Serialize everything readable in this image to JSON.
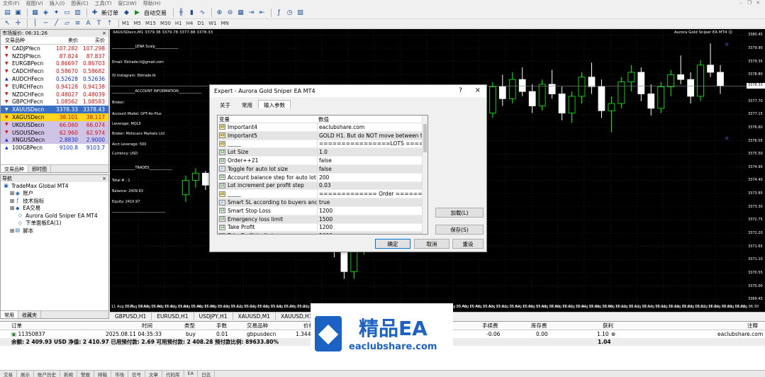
{
  "menu": [
    "文件(F)",
    "视图(V)",
    "插入(I)",
    "图表(C)",
    "工具(T)",
    "窗口(W)",
    "帮助(H)"
  ],
  "toolbar": {
    "new_order": "新订单",
    "auto_trading": "自动交易",
    "timeframes": [
      "M1",
      "M5",
      "M15",
      "M30",
      "H1",
      "H4",
      "D1",
      "W1",
      "MN"
    ]
  },
  "market_watch": {
    "title": "市场报价: 06:31:26",
    "col_symbol": "交易品种",
    "col_bid": "卖价",
    "col_ask": "买价",
    "rows": [
      {
        "symbol": "CADJPYecn",
        "bid": "107.282",
        "ask": "107.298",
        "style": "normal",
        "color": "#d01010"
      },
      {
        "symbol": "NZDJPYecn",
        "bid": "87.824",
        "ask": "87.837",
        "style": "normal",
        "color": "#d01010"
      },
      {
        "symbol": "EURGBPecn",
        "bid": "0.86697",
        "ask": "0.86703",
        "style": "normal",
        "color": "#d01010"
      },
      {
        "symbol": "CADCHFecn",
        "bid": "0.58670",
        "ask": "0.58682",
        "style": "normal",
        "color": "#d01010"
      },
      {
        "symbol": "AUDCHFecn",
        "bid": "0.52628",
        "ask": "0.52636",
        "style": "normal",
        "color": "#1030d0"
      },
      {
        "symbol": "EURCHFecn",
        "bid": "0.94128",
        "ask": "0.94138",
        "style": "normal",
        "color": "#d01010"
      },
      {
        "symbol": "NZDCHFecn",
        "bid": "0.48027",
        "ask": "0.48039",
        "style": "normal",
        "color": "#d01010"
      },
      {
        "symbol": "GBPCHFecn",
        "bid": "1.08562",
        "ask": "1.08583",
        "style": "normal",
        "color": "#d01010"
      },
      {
        "symbol": "XAUUSDecn",
        "bid": "3378.33",
        "ask": "3378.43",
        "style": "selected",
        "color": "#ffffff"
      },
      {
        "symbol": "XAGUSDecn",
        "bid": "38.101",
        "ask": "38.117",
        "style": "yellow",
        "color": "#d01010"
      },
      {
        "symbol": "UKOUSDecn",
        "bid": "66.060",
        "ask": "66.074",
        "style": "purple",
        "color": "#d01010"
      },
      {
        "symbol": "USOUSDecn",
        "bid": "62.960",
        "ask": "62.974",
        "style": "purple",
        "color": "#d01010"
      },
      {
        "symbol": "XNGUSDecn",
        "bid": "2.8830",
        "ask": "2.9000",
        "style": "purple",
        "color": "#1030d0"
      },
      {
        "symbol": "100GBPecn",
        "bid": "9100.8",
        "ask": "9103.7",
        "style": "normal",
        "color": "#1030d0"
      }
    ],
    "tabs": [
      "交易品种",
      "即时图"
    ]
  },
  "navigator": {
    "title": "导航",
    "items": [
      {
        "label": "TradeMax Global MT4",
        "indent": 0,
        "icon": "terminal-icon"
      },
      {
        "label": "账户",
        "indent": 1,
        "icon": "accounts-icon"
      },
      {
        "label": "技术指标",
        "indent": 1,
        "icon": "indicators-icon"
      },
      {
        "label": "EA交易",
        "indent": 1,
        "icon": "expert-advisors-icon"
      },
      {
        "label": "Aurora Gold Sniper EA MT4",
        "indent": 2,
        "icon": "ea-icon"
      },
      {
        "label": "下单面板EA(1)",
        "indent": 2,
        "icon": "ea-icon"
      },
      {
        "label": "脚本",
        "indent": 1,
        "icon": "scripts-icon"
      }
    ],
    "tabs": [
      "常用",
      "收藏夹"
    ]
  },
  "chart": {
    "title": "XAUUSDecn,M1  3379.38 3379.78 3377.88 3378.33",
    "ea_label": "Aurora Gold Sniper EA MT4 ☺",
    "overlay": [
      {
        "text": "_____________LENA Scalp_____________"
      },
      {
        "text": "Email:        Ebtrade.ti@gmail.com"
      },
      {
        "text": "ID Instagram:      Ebtrade.tk"
      },
      {
        "text": "_____________ACCOUNT INFORMATION_____________"
      },
      {
        "text": "Broker:"
      },
      {
        "text": "Account Model:     GPT-4o-Plus"
      },
      {
        "text": "Leverage:          MQL5"
      },
      {
        "text": "Broker:       Mohicans Markets Ltd"
      },
      {
        "text": "Acct Leverage:    500"
      },
      {
        "text": "Currency:         USD"
      },
      {
        "text": "_____________TRADES_____________"
      },
      {
        "text": "Total # :    1"
      },
      {
        "text": "Balance:          2409.93"
      },
      {
        "text": "Equity:           2410.97"
      },
      {
        "text": "______________________________"
      }
    ],
    "price_ticks": [
      "3380.45",
      "3379.90",
      "3379.35",
      "3378.80",
      "3378.25",
      "3377.70",
      "3377.15",
      "3376.60",
      "3376.05",
      "3375.50",
      "3374.95",
      "3374.40",
      "3373.85",
      "3373.30",
      "3372.75",
      "3372.20",
      "3371.65",
      "3371.10",
      "3370.55",
      "3370.00",
      "3369.45"
    ],
    "current_price": "3378.33",
    "time_ticks": [
      "11 Aug 2025",
      "11 Aug 04:58",
      "11 Aug 05:00",
      "11 Aug 05:02",
      "11 Aug 05:04",
      "11 Aug 05:06",
      "11 Aug 05:08",
      "11 Aug 05:10",
      "11 Aug 05:12",
      "11 Aug 05:14",
      "11 Aug 05:16",
      "11 Aug 05:18",
      "11 Aug 05:20",
      "11 Aug 05:22",
      "11 Aug 05:24",
      "11 Aug 05:26",
      "11 Aug 05:28",
      "11 Aug 05:30",
      "11 Aug 05:32",
      "11 Aug 05:34",
      "11 Aug 05:36",
      "11 Aug 05:38",
      "11 Aug 05:40",
      "11 Aug 05:42",
      "11 Aug 05:44",
      "11 Aug 05:46",
      "11 Aug 05:48",
      "11 Aug 05:50",
      "11 Aug 05:52",
      "11 Aug 05:54",
      "11 Aug 05:56",
      "11 Aug 05:58",
      "11 Aug 06:00",
      "11 Aug 06:02",
      "11 Aug 06:04",
      "11 Aug 06:06",
      "11 Aug 06:08",
      "11 Aug 06:10",
      "11 Aug 06:12",
      "11 Aug 06:14",
      "11 Aug 06:16",
      "11 Aug 06:18",
      "11 Aug 06:20",
      "11 Aug 06:22",
      "11 Aug 06:24",
      "11 Aug 06:26",
      "11 Aug 06:28",
      "11 Aug 06:30"
    ],
    "candle_up_color": "#00ff00",
    "candle_down_color": "#ffffff",
    "candles": [
      [
        3373.8,
        3374.6,
        3373.5,
        3374.4
      ],
      [
        3374.4,
        3374.9,
        3374.1,
        3374.7
      ],
      [
        3374.7,
        3374.8,
        3374.0,
        3374.2
      ],
      [
        3374.2,
        3374.5,
        3373.6,
        3373.9
      ],
      [
        3373.9,
        3374.3,
        3373.3,
        3373.6
      ],
      [
        3373.6,
        3374.0,
        3373.0,
        3373.8
      ],
      [
        3373.8,
        3374.8,
        3373.6,
        3374.6
      ],
      [
        3374.6,
        3375.2,
        3374.3,
        3374.9
      ],
      [
        3374.9,
        3375.0,
        3374.0,
        3374.2
      ],
      [
        3374.2,
        3374.4,
        3373.1,
        3373.4
      ],
      [
        3373.4,
        3373.9,
        3372.6,
        3373.0
      ],
      [
        3373.0,
        3373.4,
        3371.9,
        3372.2
      ],
      [
        3372.2,
        3373.2,
        3371.8,
        3372.9
      ],
      [
        3372.9,
        3373.6,
        3372.4,
        3373.4
      ],
      [
        3373.4,
        3373.8,
        3372.6,
        3372.8
      ],
      [
        3372.8,
        3373.1,
        3371.2,
        3371.5
      ],
      [
        3371.5,
        3372.0,
        3370.3,
        3370.6
      ],
      [
        3370.6,
        3371.9,
        3370.3,
        3371.6
      ],
      [
        3371.6,
        3372.7,
        3371.3,
        3372.5
      ],
      [
        3372.5,
        3373.4,
        3372.1,
        3373.2
      ],
      [
        3373.2,
        3373.6,
        3372.3,
        3372.6
      ],
      [
        3372.6,
        3373.9,
        3372.4,
        3373.7
      ],
      [
        3373.7,
        3374.6,
        3373.4,
        3374.3
      ],
      [
        3374.3,
        3375.2,
        3374.0,
        3375.0
      ],
      [
        3375.0,
        3375.6,
        3374.4,
        3374.8
      ],
      [
        3374.8,
        3375.9,
        3374.6,
        3375.7
      ],
      [
        3375.7,
        3376.4,
        3375.2,
        3376.1
      ],
      [
        3376.1,
        3376.8,
        3375.6,
        3375.9
      ],
      [
        3375.9,
        3377.2,
        3375.7,
        3377.0
      ],
      [
        3377.0,
        3377.9,
        3376.5,
        3377.6
      ],
      [
        3377.6,
        3378.1,
        3376.9,
        3377.2
      ],
      [
        3377.2,
        3378.5,
        3377.0,
        3378.3
      ],
      [
        3378.3,
        3378.8,
        3377.5,
        3377.8
      ],
      [
        3377.8,
        3378.9,
        3377.6,
        3378.6
      ],
      [
        3378.6,
        3379.1,
        3377.9,
        3378.1
      ],
      [
        3378.1,
        3378.4,
        3377.2,
        3377.5
      ],
      [
        3377.5,
        3378.6,
        3377.3,
        3378.4
      ],
      [
        3378.4,
        3379.0,
        3377.8,
        3378.0
      ],
      [
        3378.0,
        3378.3,
        3376.9,
        3377.2
      ],
      [
        3377.2,
        3378.1,
        3376.8,
        3377.9
      ],
      [
        3377.9,
        3378.9,
        3377.6,
        3378.7
      ],
      [
        3378.7,
        3379.3,
        3378.0,
        3378.3
      ],
      [
        3378.3,
        3378.6,
        3377.0,
        3377.3
      ],
      [
        3377.3,
        3377.9,
        3376.4,
        3377.6
      ],
      [
        3377.6,
        3378.7,
        3377.4,
        3378.5
      ],
      [
        3378.5,
        3379.2,
        3378.1,
        3378.9
      ],
      [
        3378.9,
        3379.1,
        3377.7,
        3378.0
      ],
      [
        3378.0,
        3378.4,
        3377.1,
        3377.4
      ],
      [
        3377.4,
        3378.5,
        3377.2,
        3378.3
      ],
      [
        3378.3,
        3379.0,
        3377.9,
        3378.8
      ],
      [
        3378.8,
        3379.6,
        3378.4,
        3378.6
      ],
      [
        3378.6,
        3378.9,
        3377.6,
        3377.9
      ],
      [
        3377.9,
        3379.4,
        3377.7,
        3379.2
      ],
      [
        3379.2,
        3380.1,
        3378.7,
        3378.9
      ],
      [
        3378.9,
        3379.2,
        3378.0,
        3378.33
      ]
    ],
    "markers": [
      {
        "label": "o",
        "price": 3380.0,
        "color": "#6a6aff"
      },
      {
        "label": "o",
        "price": 3376.1,
        "color": "#6a6aff"
      }
    ]
  },
  "chart_tabs": [
    "GBPUSD,H1",
    "EURUSD,H1",
    "USDJPY,H1",
    "XAUUSD,M1",
    "XAUUSD,H1",
    "XAUU"
  ],
  "terminal": {
    "headers": {
      "order": "订单",
      "time": "时间",
      "type": "类型",
      "lots": "手数",
      "symbol": "交易品种",
      "price": "价格",
      "swap": "手续费",
      "commission": "库存费",
      "profit": "获利",
      "comment": "注释"
    },
    "row": {
      "order": "11350837",
      "time": "2025.08.11 04:35:33",
      "type": "buy",
      "lots": "0.01",
      "symbol": "gbpusdecn",
      "price": "1.3449",
      "swap": "-0.06",
      "commission": "0.00",
      "profit": "1.10",
      "comment": "eaclubshare.com"
    },
    "summary": "余额: 2 409.93 USD  净值: 2 410.97  已用预付款: 2.69  可用预付款: 2 408.28  预付款比例: 89633.80%",
    "summary_profit": "1.04",
    "tabs": [
      "交易",
      "展示",
      "账户历史",
      "新闻",
      "警报",
      "邮箱",
      "市场",
      "信号",
      "文章",
      "代码库",
      "EA",
      "日志"
    ]
  },
  "dialog": {
    "title": "Expert - Aurora Gold Sniper EA MT4",
    "help": "?",
    "close": "×",
    "tabs": [
      "关于",
      "常用",
      "输入参数"
    ],
    "col_variable": "变量",
    "col_value": "数值",
    "params": [
      {
        "icon": "ab",
        "name": "Important4",
        "value": "eaclubshare.com"
      },
      {
        "icon": "ab",
        "name": "Important5",
        "value": "GOLD H1. But do NOT move between timeframes"
      },
      {
        "icon": "ab",
        "name": "_____",
        "value": "================LOTS ================"
      },
      {
        "icon": "num",
        "name": "Lot Size",
        "value": "1.0"
      },
      {
        "icon": "num",
        "name": "Order++21",
        "value": "false"
      },
      {
        "icon": "bool",
        "name": "Toggle for auto lot size",
        "value": "false"
      },
      {
        "icon": "num",
        "name": "Account balance step for auto lot",
        "value": "200"
      },
      {
        "icon": "num",
        "name": "Lot increment per profit step",
        "value": "0.03"
      },
      {
        "icon": "ab",
        "name": "_____",
        "value": "============= Order ============="
      },
      {
        "icon": "bool",
        "name": "Smart SL according to buyers and sellers",
        "value": "true"
      },
      {
        "icon": "num",
        "name": "Smart Stop Loss",
        "value": "1200"
      },
      {
        "icon": "num",
        "name": "Emergency loss limit",
        "value": "1500"
      },
      {
        "icon": "num",
        "name": "Take Profit",
        "value": "1200"
      },
      {
        "icon": "num",
        "name": "Take Profit trail step",
        "value": "1000"
      }
    ],
    "btn_load": "加载(L)",
    "btn_save": "保存(S)",
    "btn_ok": "确定",
    "btn_cancel": "取消",
    "btn_reset": "重设"
  },
  "watermark": {
    "cn": "精品EA",
    "url": "eaclubshare.com"
  }
}
